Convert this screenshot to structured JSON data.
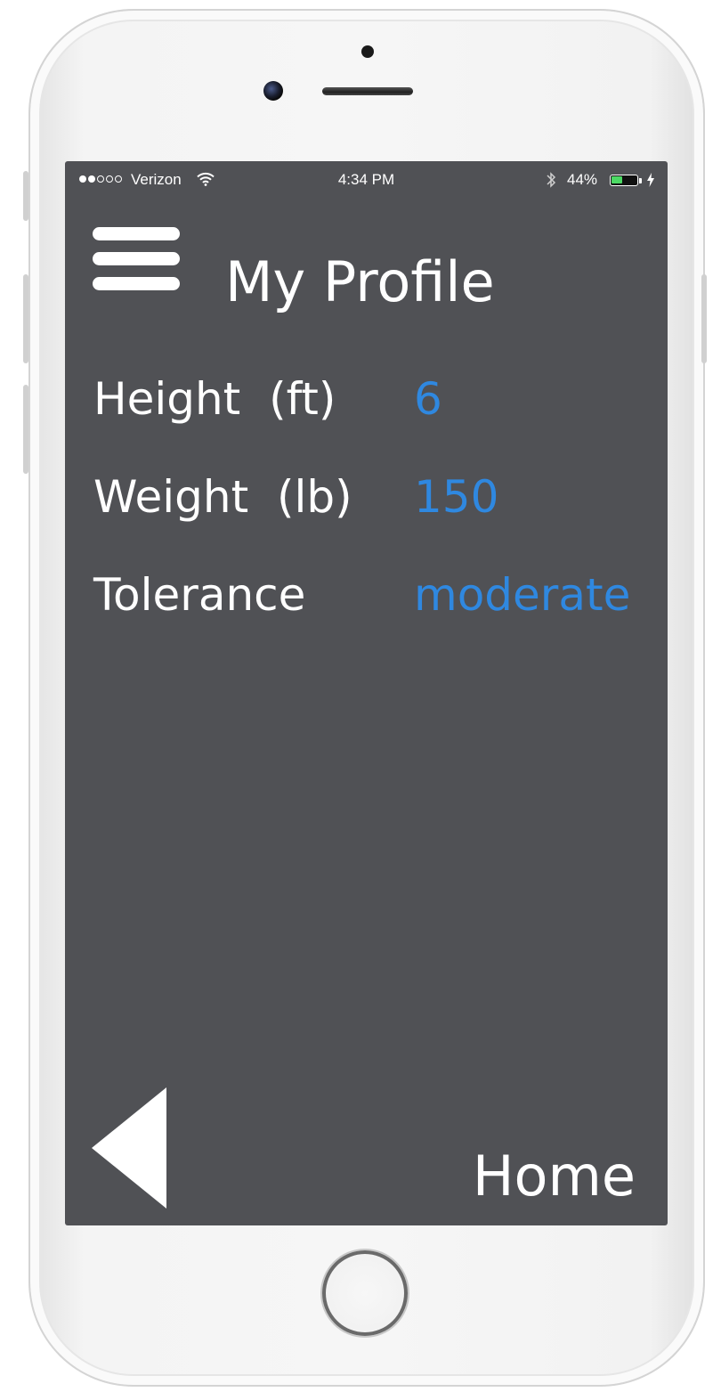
{
  "status_bar": {
    "carrier": "Verizon",
    "signal_bars_filled": 2,
    "signal_bars_total": 5,
    "time": "4:34 PM",
    "battery_percent_label": "44%",
    "battery_level": 0.44,
    "battery_color": "#4cd964"
  },
  "header": {
    "menu_icon": "hamburger-menu-icon",
    "title": "My Profile"
  },
  "profile": {
    "fields": [
      {
        "label": "Height  (ft)",
        "value": "6"
      },
      {
        "label": "Weight  (lb)",
        "value": "150"
      },
      {
        "label": "Tolerance",
        "value": "moderate"
      }
    ]
  },
  "footer": {
    "back_icon": "back-triangle-icon",
    "home_label": "Home"
  },
  "colors": {
    "screen_background": "#505155",
    "value_accent": "#2f88e0",
    "text": "#ffffff"
  }
}
